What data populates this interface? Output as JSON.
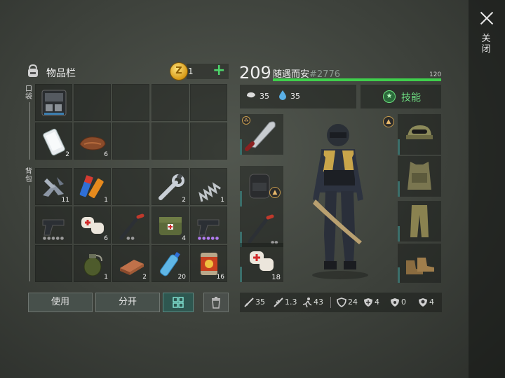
{
  "close": {
    "label": "关闭"
  },
  "inventory": {
    "title": "物品栏",
    "coins": "1",
    "pocket_label": "口袋",
    "backpack_label": "背包",
    "pocket_items": [
      {
        "icon": "tactical-case-icon",
        "count": ""
      },
      {
        "icon": "smartphone-icon",
        "count": "2"
      },
      {
        "icon": "leather-icon",
        "count": "6"
      }
    ],
    "backpack_items": [
      {
        "icon": "scrap-parts-icon",
        "count": "11"
      },
      {
        "icon": "batteries-icon",
        "count": "1"
      },
      {
        "icon": "wrench-icon",
        "count": "2"
      },
      {
        "icon": "spring-icon",
        "count": "1"
      },
      {
        "icon": "pistol-icon",
        "count": ""
      },
      {
        "icon": "bandage-icon",
        "count": "6"
      },
      {
        "icon": "crowbar-icon",
        "count": ""
      },
      {
        "icon": "medkit-bag-icon",
        "count": "4"
      },
      {
        "icon": "pistol-icon",
        "count": ""
      },
      {
        "icon": "grenade-icon",
        "count": "1"
      },
      {
        "icon": "copper-ingot-icon",
        "count": "2"
      },
      {
        "icon": "water-bottle-icon",
        "count": "20"
      },
      {
        "icon": "canned-food-icon",
        "count": "16"
      }
    ],
    "buttons": {
      "use": "使用",
      "split": "分开"
    }
  },
  "character": {
    "level": "209",
    "name": "随遇而安",
    "id": "#2776",
    "xp_max": "120",
    "xp_fraction": 1.0,
    "food": "35",
    "water": "35",
    "skills_label": "技能",
    "left_gear": [
      {
        "icon": "machete-icon",
        "count": ""
      },
      {
        "icon": "backpack-icon",
        "count": ""
      },
      {
        "icon": "crowbar-icon",
        "count": ""
      },
      {
        "icon": "bandage-icon",
        "count": "18"
      }
    ],
    "right_gear": [
      {
        "icon": "cap-icon"
      },
      {
        "icon": "vest-icon"
      },
      {
        "icon": "pants-icon"
      },
      {
        "icon": "boots-icon"
      }
    ],
    "stats": {
      "melee": "35",
      "speed": "1.3",
      "move": "43",
      "armor": "24",
      "cold": "4",
      "radiation": "0",
      "poison": "4"
    }
  },
  "colors": {
    "accent_green": "#3fcf4c",
    "skills_green": "#6fe083",
    "panel": "#3d413b"
  }
}
